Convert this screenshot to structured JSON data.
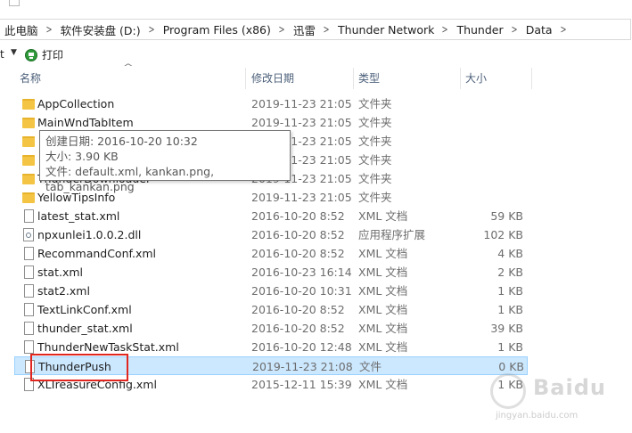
{
  "breadcrumb": [
    "此电脑",
    "软件安装盘 (D:)",
    "Program Files (x86)",
    "迅雷",
    "Thunder Network",
    "Thunder",
    "Data"
  ],
  "toolbar": {
    "cut_label": "t",
    "print_label": "打印"
  },
  "columns": {
    "name": "名称",
    "date": "修改日期",
    "type": "类型",
    "size": "大小"
  },
  "files": [
    {
      "name": "AppCollection",
      "date": "2019-11-23 21:05",
      "type": "文件夹",
      "size": "",
      "icon": "folder-icon"
    },
    {
      "name": "MainWndTabItem",
      "date": "2019-11-23 21:05",
      "type": "文件夹",
      "size": "",
      "icon": "folder-icon"
    },
    {
      "name": "",
      "date": "2019-11-23 21:05",
      "type": "文件夹",
      "size": "",
      "icon": "folder-icon"
    },
    {
      "name": "",
      "date": "2019-11-23 21:05",
      "type": "文件夹",
      "size": "",
      "icon": "folder-icon"
    },
    {
      "name": "ThunderDownloader",
      "date": "2019-11-23 21:05",
      "type": "文件夹",
      "size": "",
      "icon": "folder-icon"
    },
    {
      "name": "YellowTipsInfo",
      "date": "2019-11-23 21:05",
      "type": "文件夹",
      "size": "",
      "icon": "folder-icon"
    },
    {
      "name": "latest_stat.xml",
      "date": "2016-10-20 8:52",
      "type": "XML 文档",
      "size": "59 KB",
      "icon": "document-icon"
    },
    {
      "name": "npxunlei1.0.0.2.dll",
      "date": "2016-10-20 8:52",
      "type": "应用程序扩展",
      "size": "102 KB",
      "icon": "dll-icon"
    },
    {
      "name": "RecommandConf.xml",
      "date": "2016-10-20 8:52",
      "type": "XML 文档",
      "size": "4 KB",
      "icon": "document-icon"
    },
    {
      "name": "stat.xml",
      "date": "2016-10-23 16:14",
      "type": "XML 文档",
      "size": "2 KB",
      "icon": "document-icon"
    },
    {
      "name": "stat2.xml",
      "date": "2016-10-20 10:31",
      "type": "XML 文档",
      "size": "1 KB",
      "icon": "document-icon"
    },
    {
      "name": "TextLinkConf.xml",
      "date": "2016-10-20 8:52",
      "type": "XML 文档",
      "size": "1 KB",
      "icon": "document-icon"
    },
    {
      "name": "thunder_stat.xml",
      "date": "2016-10-20 8:52",
      "type": "XML 文档",
      "size": "39 KB",
      "icon": "document-icon"
    },
    {
      "name": "ThunderNewTaskStat.xml",
      "date": "2016-10-20 12:48",
      "type": "XML 文档",
      "size": "1 KB",
      "icon": "document-icon"
    },
    {
      "name": "ThunderPush",
      "date": "2019-11-23 21:08",
      "type": "文件",
      "size": "0 KB",
      "icon": "document-icon",
      "selected": true
    },
    {
      "name": "XLTreasureConfig.xml",
      "date": "2015-12-11 15:39",
      "type": "XML 文档",
      "size": "1 KB",
      "icon": "document-icon"
    }
  ],
  "tooltip": {
    "created": "创建日期: 2016-10-20 10:32",
    "size": "大小: 3.90 KB",
    "files": "文件: default.xml, kankan.png, tab_kankan.png"
  },
  "watermark": {
    "text": "Baidu",
    "url": "jingyan.baidu.com"
  },
  "colors": {
    "selected_bg": "#cce8ff",
    "highlight": "#e0261e",
    "folder": "#f4c544",
    "header_text": "#4c607a"
  }
}
